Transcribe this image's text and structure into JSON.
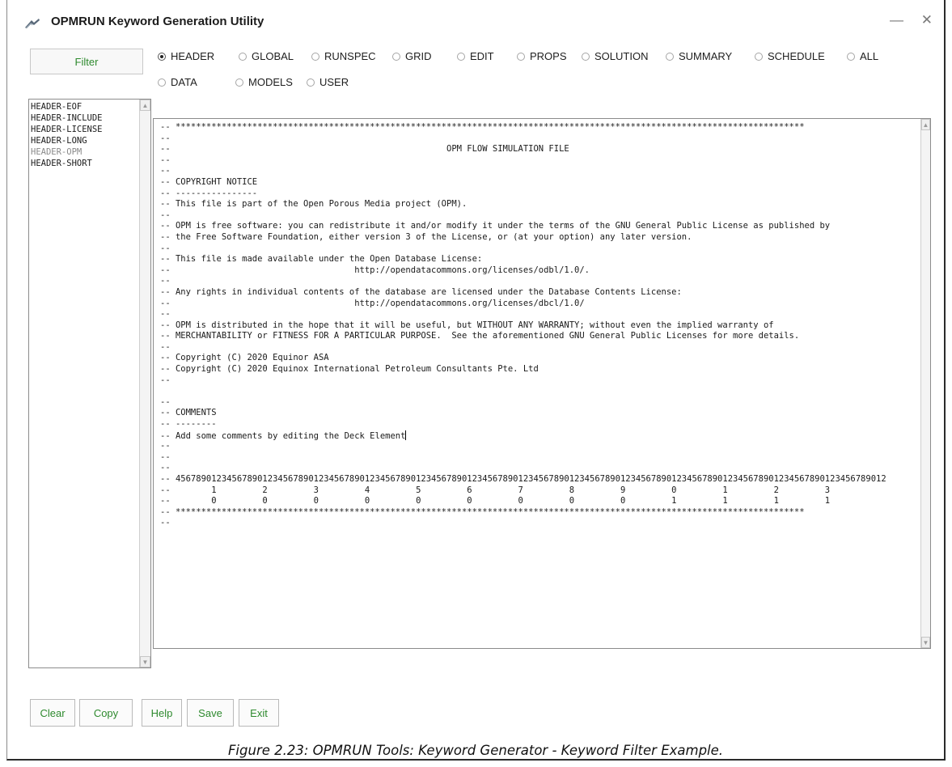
{
  "window": {
    "title": "OPMRUN Keyword Generation Utility",
    "minimize_glyph": "—",
    "close_glyph": "✕"
  },
  "filter_label": "Filter",
  "sections": [
    {
      "label": "HEADER",
      "checked": true
    },
    {
      "label": "GLOBAL",
      "checked": false
    },
    {
      "label": "RUNSPEC",
      "checked": false
    },
    {
      "label": "GRID",
      "checked": false
    },
    {
      "label": "EDIT",
      "checked": false
    },
    {
      "label": "PROPS",
      "checked": false
    },
    {
      "label": "SOLUTION",
      "checked": false
    },
    {
      "label": "SUMMARY",
      "checked": false
    },
    {
      "label": "SCHEDULE",
      "checked": false
    },
    {
      "label": "ALL",
      "checked": false
    },
    {
      "label": "DATA",
      "checked": false
    },
    {
      "label": "MODELS",
      "checked": false
    },
    {
      "label": "USER",
      "checked": false
    }
  ],
  "keywords": [
    "HEADER-EOF",
    "HEADER-INCLUDE",
    "HEADER-LICENSE",
    "HEADER-LONG",
    "HEADER-OPM",
    "HEADER-SHORT"
  ],
  "selected_keyword": "HEADER-OPM",
  "editor_lines": [
    "-- ***************************************************************************************************************************",
    "--",
    "--                                                      OPM FLOW SIMULATION FILE",
    "--",
    "--",
    "-- COPYRIGHT NOTICE",
    "-- ----------------",
    "-- This file is part of the Open Porous Media project (OPM).",
    "--",
    "-- OPM is free software: you can redistribute it and/or modify it under the terms of the GNU General Public License as published by",
    "-- the Free Software Foundation, either version 3 of the License, or (at your option) any later version.",
    "--",
    "-- This file is made available under the Open Database License:",
    "--                                    http://opendatacommons.org/licenses/odbl/1.0/.",
    "--",
    "-- Any rights in individual contents of the database are licensed under the Database Contents License:",
    "--                                    http://opendatacommons.org/licenses/dbcl/1.0/",
    "--",
    "-- OPM is distributed in the hope that it will be useful, but WITHOUT ANY WARRANTY; without even the implied warranty of",
    "-- MERCHANTABILITY or FITNESS FOR A PARTICULAR PURPOSE.  See the aforementioned GNU General Public Licenses for more details.",
    "--",
    "-- Copyright (C) 2020 Equinor ASA",
    "-- Copyright (C) 2020 Equinox International Petroleum Consultants Pte. Ltd",
    "--",
    "",
    "--",
    "-- COMMENTS",
    "-- --------",
    "-- Add some comments by editing the Deck Element",
    "--",
    "--",
    "--",
    "-- 4567890123456789012345678901234567890123456789012345678901234567890123456789012345678901234567890123456789012345678901234567890123456789012",
    "--        1         2         3         4         5         6         7         8         9         0         1         2         3",
    "--        0         0         0         0         0         0         0         0         0         1         1         1         1",
    "-- ***************************************************************************************************************************",
    "--"
  ],
  "buttons": {
    "clear": "Clear",
    "copy": "Copy",
    "help": "Help",
    "save": "Save",
    "exit": "Exit"
  },
  "caption": "Figure 2.23: OPMRUN Tools: Keyword Generator - Keyword Filter Example.",
  "colors": {
    "button_text": "#2e8a2e",
    "selected_keyword_text": "#8a8a8a"
  }
}
